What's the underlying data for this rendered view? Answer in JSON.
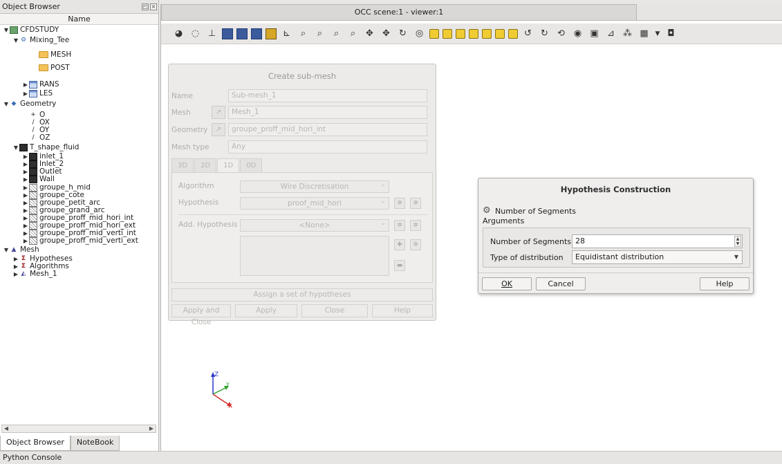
{
  "object_browser": {
    "title": "Object Browser",
    "column_header": "Name",
    "tree": [
      {
        "label": "CFDSTUDY",
        "icon": "study-icon",
        "arrow": "▼"
      },
      {
        "label": "Mixing_Tee",
        "icon": "case-icon",
        "arrow": "▼"
      },
      {
        "label": "MESH",
        "icon": "folder-icon",
        "arrow": ""
      },
      {
        "label": "POST",
        "icon": "folder-icon",
        "arrow": ""
      },
      {
        "label": "RANS",
        "icon": "table-icon",
        "arrow": "▶"
      },
      {
        "label": "LES",
        "icon": "table-icon",
        "arrow": "▶"
      },
      {
        "label": "Geometry",
        "icon": "geometry-icon",
        "arrow": "▼"
      },
      {
        "label": "O",
        "icon": "point-icon",
        "arrow": ""
      },
      {
        "label": "OX",
        "icon": "vector-icon",
        "arrow": ""
      },
      {
        "label": "OY",
        "icon": "vector-icon",
        "arrow": ""
      },
      {
        "label": "OZ",
        "icon": "vector-icon",
        "arrow": ""
      },
      {
        "label": "T_shape_fluid",
        "icon": "solid-icon",
        "arrow": "▼"
      },
      {
        "label": "inlet_1",
        "icon": "group-icon",
        "arrow": "▶"
      },
      {
        "label": "Inlet_2",
        "icon": "group-icon",
        "arrow": "▶"
      },
      {
        "label": "Outlet",
        "icon": "group-icon",
        "arrow": "▶"
      },
      {
        "label": "Wall",
        "icon": "group-icon",
        "arrow": "▶"
      },
      {
        "label": "groupe_h_mid",
        "icon": "hatch-icon",
        "arrow": "▶"
      },
      {
        "label": "groupe_cote",
        "icon": "hatch-icon",
        "arrow": "▶"
      },
      {
        "label": "groupe_petit_arc",
        "icon": "hatch-icon",
        "arrow": "▶"
      },
      {
        "label": "groupe_grand_arc",
        "icon": "hatch-icon",
        "arrow": "▶"
      },
      {
        "label": "groupe_proff_mid_hori_int",
        "icon": "hatch-icon",
        "arrow": "▶"
      },
      {
        "label": "groupe_proff_mid_hori_ext",
        "icon": "hatch-icon",
        "arrow": "▶"
      },
      {
        "label": "groupe_proff_mid_verti_int",
        "icon": "hatch-icon",
        "arrow": "▶"
      },
      {
        "label": "groupe_proff_mid_verti_ext",
        "icon": "hatch-icon",
        "arrow": "▶"
      },
      {
        "label": "Mesh",
        "icon": "mesh-icon",
        "arrow": "▼"
      },
      {
        "label": "Hypotheses",
        "icon": "sigma-icon",
        "arrow": "▶"
      },
      {
        "label": "Algorithms",
        "icon": "sigma-icon",
        "arrow": "▶"
      },
      {
        "label": "Mesh_1",
        "icon": "mesh-object-icon",
        "arrow": "▶"
      }
    ],
    "tabs": [
      "Object Browser",
      "NoteBook"
    ]
  },
  "python_console": "Python Console",
  "viewer": {
    "tab_title": "OCC scene:1 - viewer:1"
  },
  "submesh_dialog": {
    "title": "Create sub-mesh",
    "name_label": "Name",
    "name_value": "Sub-mesh_1",
    "mesh_label": "Mesh",
    "mesh_value": "Mesh_1",
    "geometry_label": "Geometry",
    "geometry_value": "groupe_proff_mid_hori_int",
    "mesh_type_label": "Mesh type",
    "mesh_type_value": "Any",
    "tabs": [
      "3D",
      "2D",
      "1D",
      "0D"
    ],
    "algorithm_label": "Algorithm",
    "algorithm_value": "Wire Discretisation",
    "hypothesis_label": "Hypothesis",
    "hypothesis_value": "proof_mid_hori",
    "add_hypothesis_label": "Add. Hypothesis",
    "add_hypothesis_value": "<None>",
    "assign_set_label": "Assign a set of hypotheses",
    "buttons": {
      "apply_close": "Apply and Close",
      "apply": "Apply",
      "close": "Close",
      "help": "Help"
    }
  },
  "hypothesis_dialog": {
    "title": "Hypothesis Construction",
    "hypothesis_name": "Number of Segments",
    "arguments_label": "Arguments",
    "num_segments_label": "Number of Segments",
    "num_segments_value": "28",
    "distribution_label": "Type of distribution",
    "distribution_value": "Equidistant distribution",
    "ok": "OK",
    "cancel": "Cancel",
    "help": "Help"
  },
  "triad": {
    "x": "X",
    "y": "Y",
    "z": "Z"
  }
}
